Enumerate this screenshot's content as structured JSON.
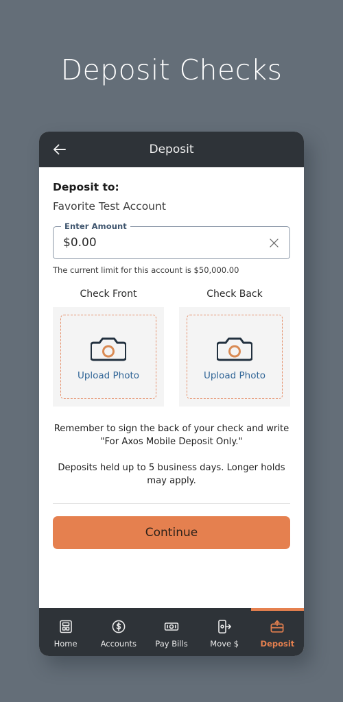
{
  "page": {
    "title": "Deposit Checks",
    "background_color": "#646e78"
  },
  "appbar": {
    "title": "Deposit",
    "back_icon": "arrow-left-icon",
    "background_color": "#2e3338"
  },
  "form": {
    "deposit_to_label": "Deposit to:",
    "account_name": "Favorite Test Account",
    "amount_field": {
      "legend": "Enter Amount",
      "value": "$0.00",
      "placeholder": "$0.00",
      "clear_icon": "close-icon"
    },
    "limit_text": "The current limit for this account is $50,000.00"
  },
  "uploads": [
    {
      "caption": "Check Front",
      "action_label": "Upload Photo",
      "icon": "camera-icon"
    },
    {
      "caption": "Check Back",
      "action_label": "Upload Photo",
      "icon": "camera-icon"
    }
  ],
  "disclaimers": {
    "sign_notice": "Remember to sign the back of your check and write \"For Axos Mobile Deposit Only.\"",
    "hold_notice": "Deposits held up to 5 business days. Longer holds may apply."
  },
  "actions": {
    "continue_label": "Continue",
    "continue_color": "#e5804f"
  },
  "bottom_nav": {
    "active_color": "#e5804f",
    "items": [
      {
        "label": "Home",
        "icon": "home-building-icon",
        "active": false
      },
      {
        "label": "Accounts",
        "icon": "dollar-circle-icon",
        "active": false
      },
      {
        "label": "Pay Bills",
        "icon": "banknote-icon",
        "active": false
      },
      {
        "label": "Move $",
        "icon": "phone-arrow-icon",
        "active": false
      },
      {
        "label": "Deposit",
        "icon": "deposit-tray-icon",
        "active": true
      }
    ]
  }
}
